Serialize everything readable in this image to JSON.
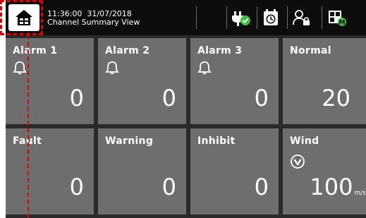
{
  "header": {
    "time": "11:36:00",
    "date": "31/07/2018",
    "view_title": "Channel Summary View"
  },
  "toolbar_icons": [
    "home-icon",
    "power-plug-status-icon",
    "calendar-clock-icon",
    "user-lock-icon",
    "menu-grid-icon"
  ],
  "status_colors": {
    "ok": "#3fbf3f",
    "tile": "#6e6e6e",
    "header": "#0d0d0d",
    "highlight": "#e00000"
  },
  "tiles": [
    {
      "label": "Alarm 1",
      "value": "0",
      "icon": "bell-icon"
    },
    {
      "label": "Alarm 2",
      "value": "0",
      "icon": "bell-icon"
    },
    {
      "label": "Alarm 3",
      "value": "0",
      "icon": "bell-icon"
    },
    {
      "label": "Normal",
      "value": "20"
    },
    {
      "label": "Fault",
      "value": "0"
    },
    {
      "label": "Warning",
      "value": "0"
    },
    {
      "label": "Inhibit",
      "value": "0"
    },
    {
      "label": "Wind",
      "value": "100",
      "unit": "m/s",
      "icon": "wind-direction-icon"
    }
  ]
}
